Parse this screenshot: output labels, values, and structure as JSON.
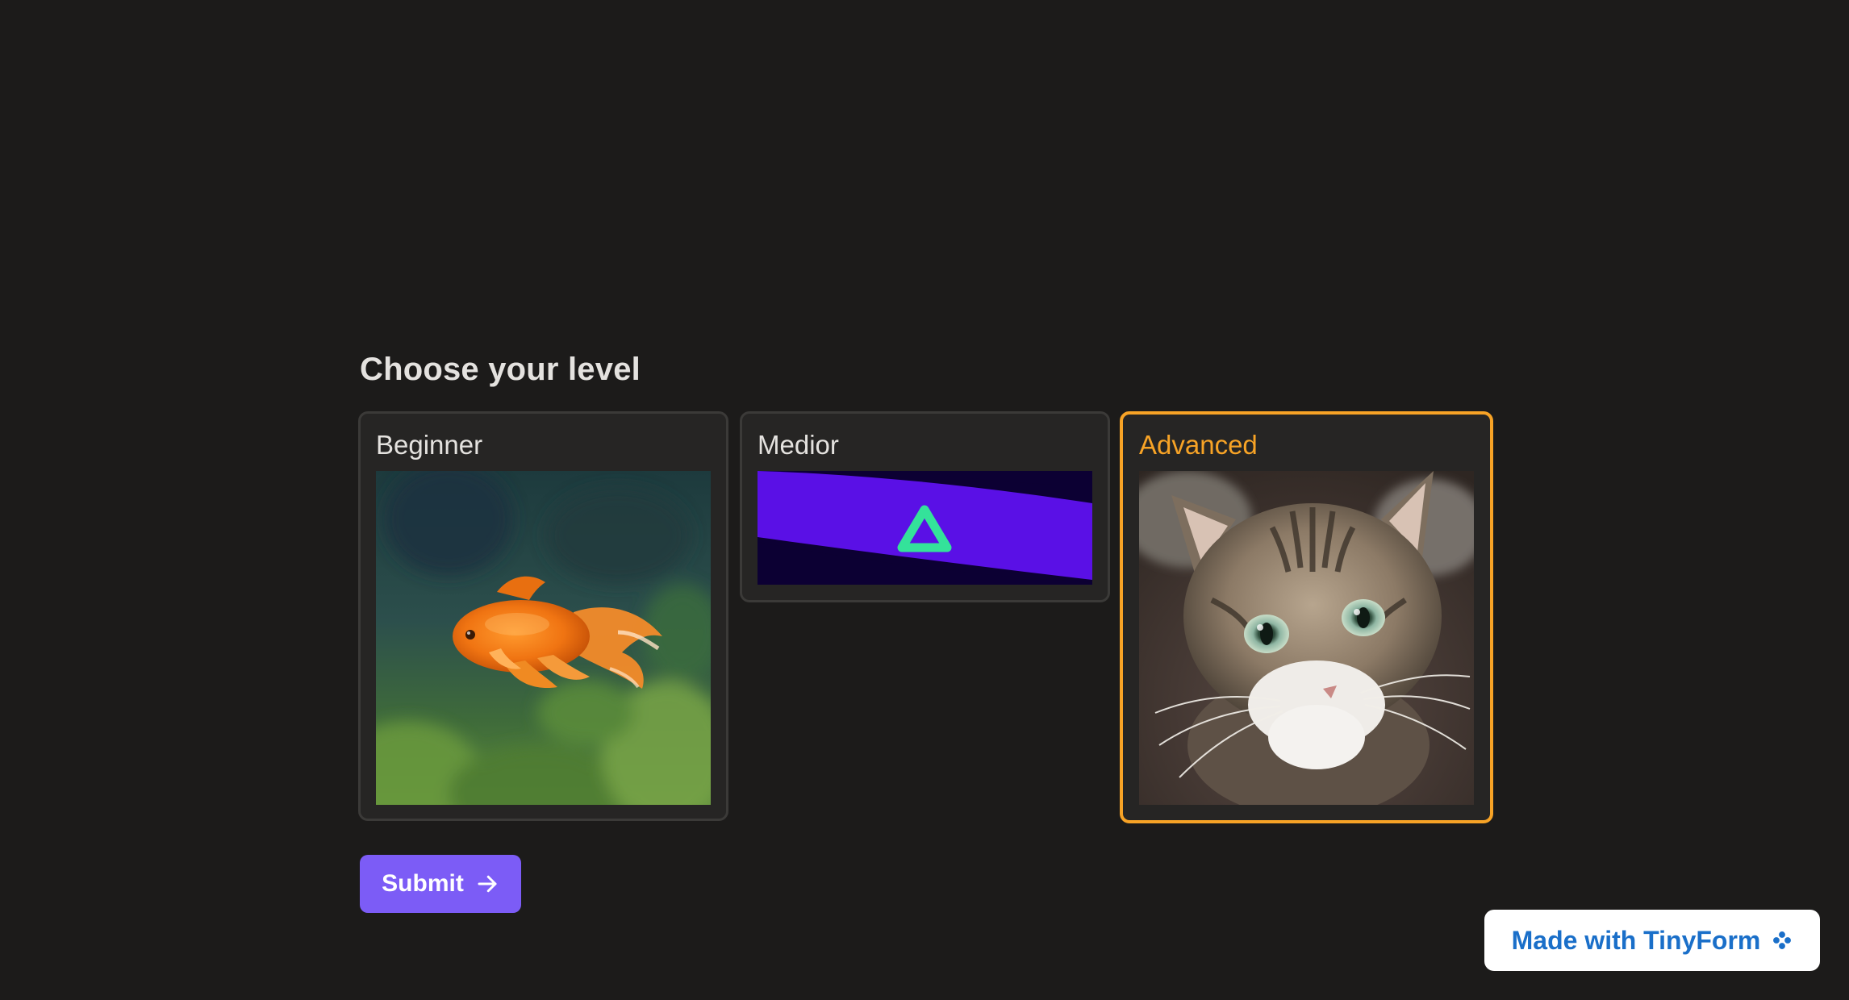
{
  "question": {
    "title": "Choose your level"
  },
  "choices": [
    {
      "label": "Beginner",
      "image": "goldfish-photo",
      "selected": false
    },
    {
      "label": "Medior",
      "image": "purple-band-green-triangle-logo",
      "selected": false
    },
    {
      "label": "Advanced",
      "image": "tabby-cat-photo",
      "selected": true
    }
  ],
  "submit": {
    "label": "Submit",
    "icon": "arrow-right-icon"
  },
  "branding": {
    "label": "Made with TinyForm",
    "icon": "tinyform-flower-icon"
  },
  "colors": {
    "background": "#1c1b1a",
    "card": "#262524",
    "selected_accent": "#f7a326",
    "submit": "#7c5cf6",
    "branding_text": "#1a6fc9"
  }
}
